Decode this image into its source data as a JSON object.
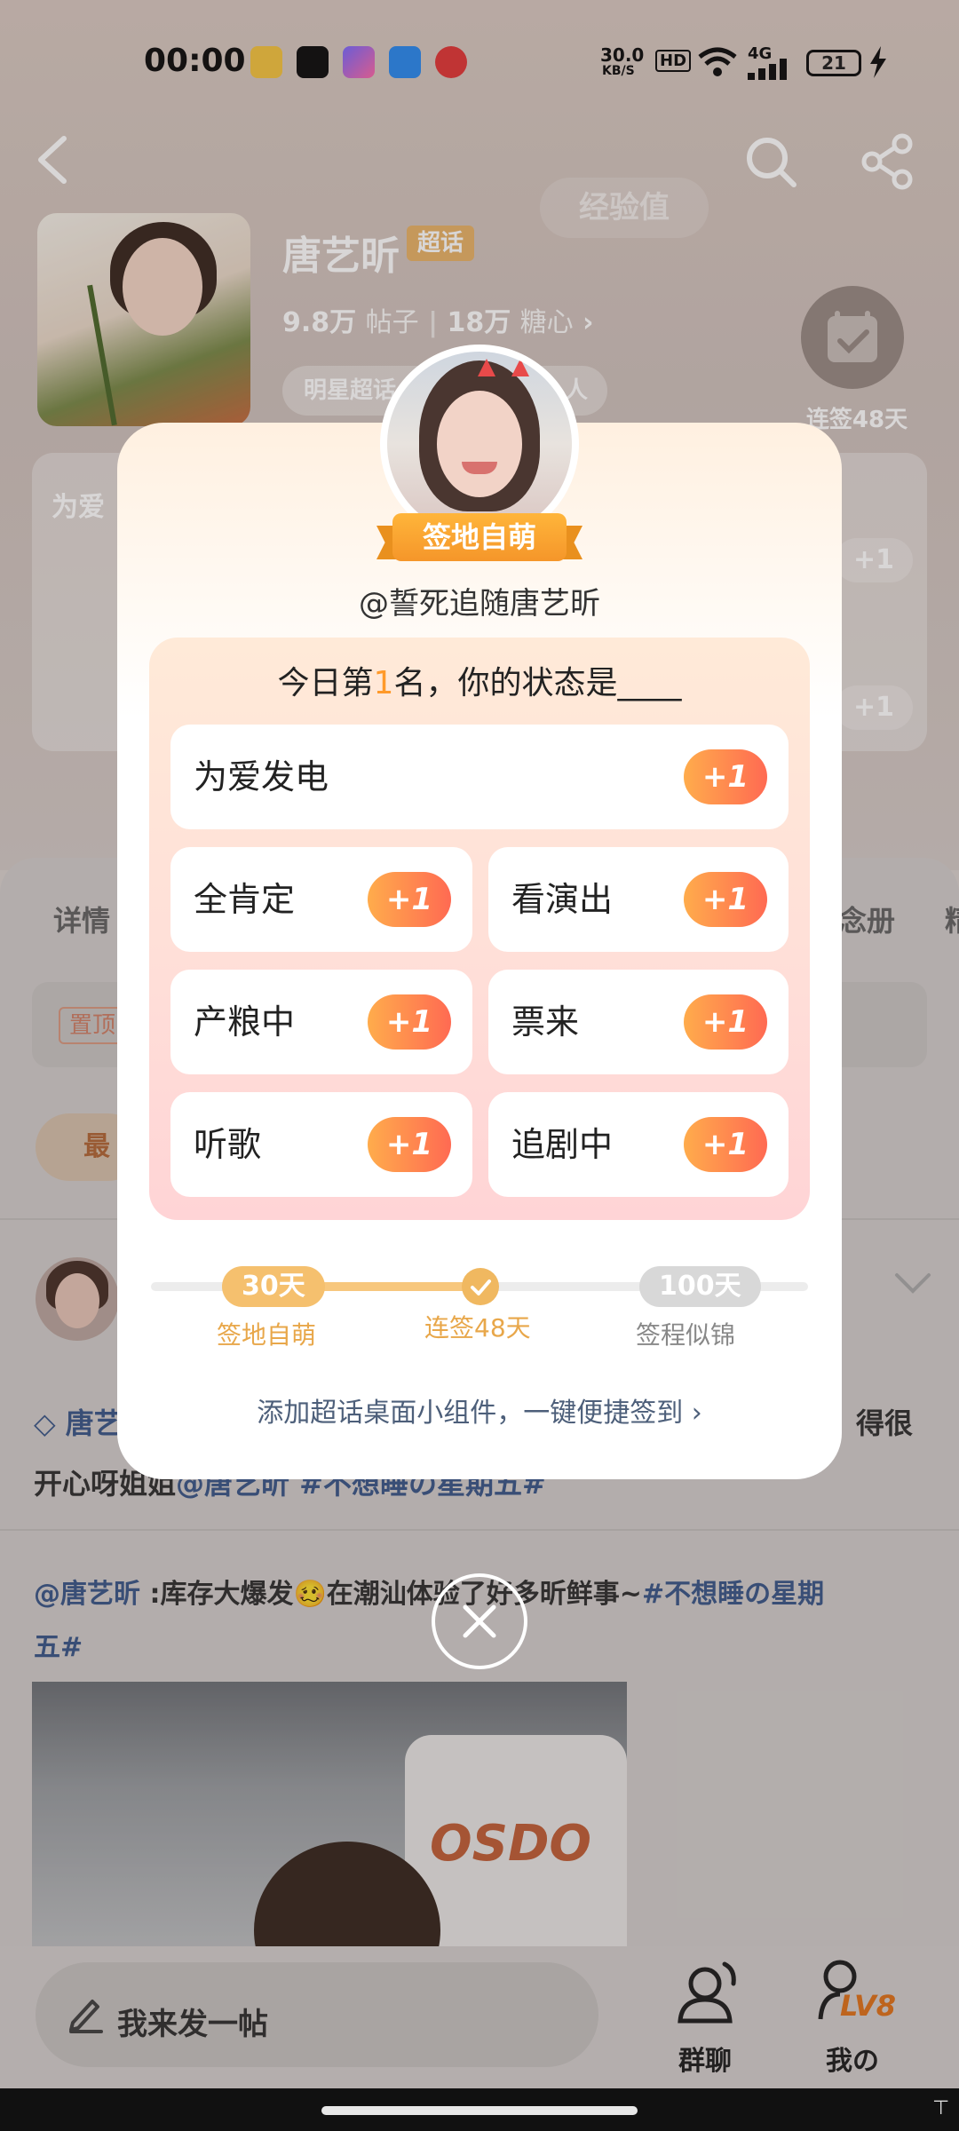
{
  "status_bar": {
    "time": "00:00",
    "net_speed_value": "30.0",
    "net_speed_unit": "KB/S",
    "hd": "HD",
    "network": "4G",
    "battery": "21"
  },
  "header": {
    "exp_label": "经验值",
    "topic_name": "唐艺昕",
    "topic_tag": "超话",
    "posts_count": "9.8万",
    "posts_label": "帖子",
    "sugar_count": "18万",
    "sugar_label": "糖心",
    "rank_label": "明星超话",
    "rank_tail": "人",
    "checkin_label": "连签48天"
  },
  "bg_card": {
    "title": "为爱",
    "plus": "+1"
  },
  "tabs": {
    "detail": "详情",
    "album": "念册",
    "more": "精"
  },
  "pinned_tag": "置顶",
  "sort_label": "最",
  "post": {
    "author_line_prefix": "唐艺",
    "author_line_suffix": "得很",
    "line2_a": "开心呀姐姐",
    "line2_b": "@唐艺昕 #不想睡の星期五#",
    "repost_author": "@唐艺昕",
    "repost_text": " :库存大爆发🥴在潮汕体验了好多昕鲜事~",
    "repost_topic_a": "#不想睡の星期",
    "repost_topic_b": "五#",
    "image_text": "OSDO"
  },
  "bottom": {
    "compose_label": "我来发一帖",
    "groupchat_label": "群聊",
    "me_label": "我の",
    "level": "LV8"
  },
  "modal": {
    "badge": "签地自萌",
    "username": "@誓死追随唐艺昕",
    "status_prefix": "今日第",
    "rank_number": "1",
    "status_suffix": "名，你的状态是____",
    "options": [
      {
        "label": "为爱发电",
        "button": "+1"
      },
      {
        "label": "全肯定",
        "button": "+1"
      },
      {
        "label": "看演出",
        "button": "+1"
      },
      {
        "label": "产粮中",
        "button": "+1"
      },
      {
        "label": "票来",
        "button": "+1"
      },
      {
        "label": "听歌",
        "button": "+1"
      },
      {
        "label": "追剧中",
        "button": "+1"
      }
    ],
    "progress": {
      "milestone1_days": "30天",
      "milestone1_label": "签地自萌",
      "current_label": "连签48天",
      "milestone3_days": "100天",
      "milestone3_label": "签程似锦",
      "current_days": 48,
      "max_days": 100
    },
    "widget_link": "添加超话桌面小组件，一键便捷签到"
  }
}
